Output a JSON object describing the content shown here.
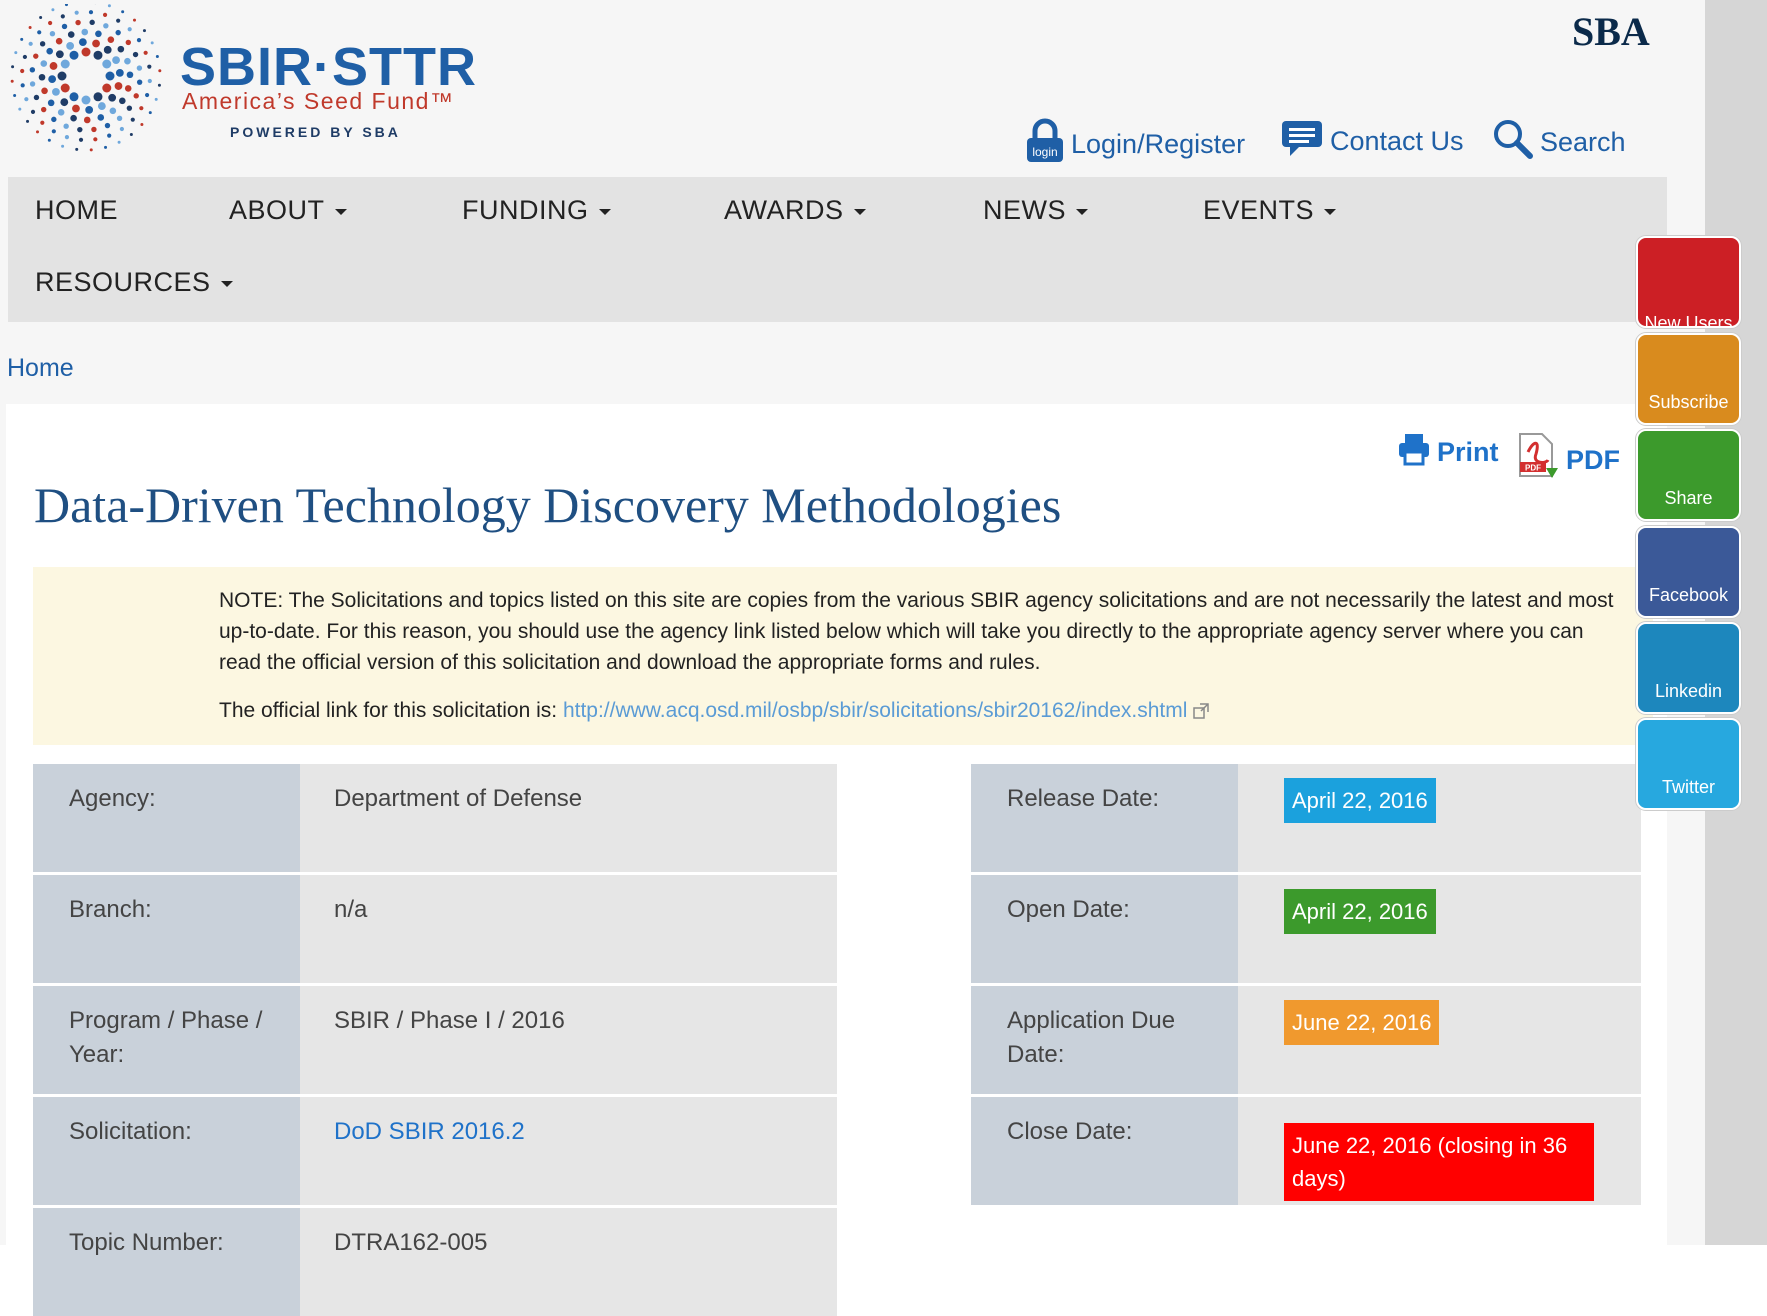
{
  "header": {
    "logo_title": "SBIR·STTR",
    "logo_tagline": "America’s Seed Fund™",
    "logo_powered": "POWERED BY SBA",
    "sba_mark": "SBA",
    "login_label": "Login/Register",
    "contact_label": "Contact Us",
    "search_label": "Search"
  },
  "nav": {
    "items": [
      "HOME",
      "ABOUT",
      "FUNDING",
      "AWARDS",
      "NEWS",
      "EVENTS",
      "RESOURCES"
    ]
  },
  "breadcrumb": {
    "home": "Home"
  },
  "page": {
    "title": "Data-Driven Technology Discovery Methodologies",
    "print_label": "Print",
    "pdf_label": "PDF"
  },
  "note": {
    "text": "NOTE: The Solicitations and topics listed on this site are copies from the various SBIR agency solicitations and are not necessarily the latest and most up-to-date. For this reason, you should use the agency link listed below which will take you directly to the appropriate agency server where you can read the official version of this solicitation and download the appropriate forms and rules.",
    "link_prefix": "The official link for this solicitation is:",
    "link_url": "http://www.acq.osd.mil/osbp/sbir/solicitations/sbir20162/index.shtml"
  },
  "details_left": [
    {
      "label": "Agency:",
      "value": "Department of Defense"
    },
    {
      "label": "Branch:",
      "value": "n/a"
    },
    {
      "label": "Program / Phase / Year:",
      "value": "SBIR / Phase I / 2016"
    },
    {
      "label": "Solicitation:",
      "value": "DoD SBIR 2016.2"
    },
    {
      "label": "Topic Number:",
      "value": "DTRA162-005"
    }
  ],
  "details_right": [
    {
      "label": "Release Date:",
      "value": "April 22, 2016",
      "color": "#1ba1dd"
    },
    {
      "label": "Open Date:",
      "value": "April 22, 2016",
      "color": "#3c9a2c"
    },
    {
      "label": "Application Due Date:",
      "value": "June 22, 2016",
      "color": "#f0992e"
    },
    {
      "label": "Close Date:",
      "value": "June 22, 2016 (closing in 36 days)",
      "color": "#ff0000"
    }
  ],
  "social": [
    {
      "label": "New Users",
      "color": "#cc1f25"
    },
    {
      "label": "Subscribe",
      "color": "#d98b1e"
    },
    {
      "label": "Share",
      "color": "#3c9a2c"
    },
    {
      "label": "Facebook",
      "color": "#3b5998"
    },
    {
      "label": "Linkedin",
      "color": "#1d87bd"
    },
    {
      "label": "Twitter",
      "color": "#27a8df"
    }
  ],
  "colors": {
    "brand_blue": "#1f5fa6",
    "link": "#5a9bd5",
    "note_bg": "#fcf7e1",
    "label_bg": "#c9d1da",
    "value_bg": "#e6e6e6"
  }
}
